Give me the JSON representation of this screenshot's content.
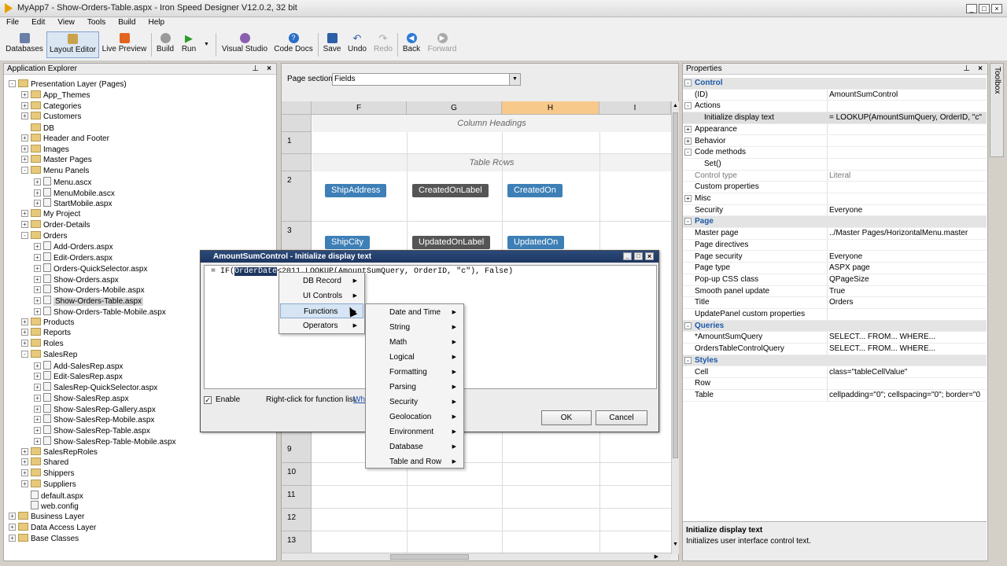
{
  "window": {
    "title": "MyApp7 - Show-Orders-Table.aspx - Iron Speed Designer V12.0.2, 32 bit"
  },
  "menu": [
    "File",
    "Edit",
    "View",
    "Tools",
    "Build",
    "Help"
  ],
  "toolbar": [
    {
      "label": "Databases",
      "icon": "database-icon",
      "enabled": true
    },
    {
      "label": "Layout Editor",
      "icon": "layout-icon",
      "enabled": true,
      "active": true
    },
    {
      "label": "Live Preview",
      "icon": "preview-icon",
      "enabled": true
    },
    {
      "label": "Build",
      "icon": "gear-icon",
      "enabled": true
    },
    {
      "label": "Run",
      "icon": "play-icon",
      "enabled": true
    },
    {
      "label": "Visual Studio",
      "icon": "visual-studio-icon",
      "enabled": true
    },
    {
      "label": "Code Docs",
      "icon": "help-icon",
      "enabled": true
    },
    {
      "label": "Save",
      "icon": "save-icon",
      "enabled": true
    },
    {
      "label": "Undo",
      "icon": "undo-icon",
      "enabled": true
    },
    {
      "label": "Redo",
      "icon": "redo-icon",
      "enabled": false
    },
    {
      "label": "Back",
      "icon": "back-icon",
      "enabled": true
    },
    {
      "label": "Forward",
      "icon": "forward-icon",
      "enabled": false
    }
  ],
  "explorer": {
    "title": "Application Explorer",
    "nodes": [
      {
        "label": "Presentation Layer (Pages)",
        "indent": 0,
        "exp": "-",
        "type": "folder"
      },
      {
        "label": "App_Themes",
        "indent": 1,
        "exp": "+",
        "type": "folder"
      },
      {
        "label": "Categories",
        "indent": 1,
        "exp": "+",
        "type": "folder"
      },
      {
        "label": "Customers",
        "indent": 1,
        "exp": "+",
        "type": "folder"
      },
      {
        "label": "DB",
        "indent": 1,
        "exp": "",
        "type": "folder"
      },
      {
        "label": "Header and Footer",
        "indent": 1,
        "exp": "+",
        "type": "folder"
      },
      {
        "label": "Images",
        "indent": 1,
        "exp": "+",
        "type": "folder"
      },
      {
        "label": "Master Pages",
        "indent": 1,
        "exp": "+",
        "type": "folder"
      },
      {
        "label": "Menu Panels",
        "indent": 1,
        "exp": "-",
        "type": "folder"
      },
      {
        "label": "Menu.ascx",
        "indent": 2,
        "exp": "+",
        "type": "file"
      },
      {
        "label": "MenuMobile.ascx",
        "indent": 2,
        "exp": "+",
        "type": "file"
      },
      {
        "label": "StartMobile.aspx",
        "indent": 2,
        "exp": "+",
        "type": "file"
      },
      {
        "label": "My Project",
        "indent": 1,
        "exp": "+",
        "type": "folder"
      },
      {
        "label": "Order-Details",
        "indent": 1,
        "exp": "+",
        "type": "folder"
      },
      {
        "label": "Orders",
        "indent": 1,
        "exp": "-",
        "type": "folder"
      },
      {
        "label": "Add-Orders.aspx",
        "indent": 2,
        "exp": "+",
        "type": "file"
      },
      {
        "label": "Edit-Orders.aspx",
        "indent": 2,
        "exp": "+",
        "type": "file"
      },
      {
        "label": "Orders-QuickSelector.aspx",
        "indent": 2,
        "exp": "+",
        "type": "file"
      },
      {
        "label": "Show-Orders.aspx",
        "indent": 2,
        "exp": "+",
        "type": "file"
      },
      {
        "label": "Show-Orders-Mobile.aspx",
        "indent": 2,
        "exp": "+",
        "type": "file"
      },
      {
        "label": "Show-Orders-Table.aspx",
        "indent": 2,
        "exp": "+",
        "type": "file",
        "selected": true
      },
      {
        "label": "Show-Orders-Table-Mobile.aspx",
        "indent": 2,
        "exp": "+",
        "type": "file"
      },
      {
        "label": "Products",
        "indent": 1,
        "exp": "+",
        "type": "folder"
      },
      {
        "label": "Reports",
        "indent": 1,
        "exp": "+",
        "type": "folder"
      },
      {
        "label": "Roles",
        "indent": 1,
        "exp": "+",
        "type": "folder"
      },
      {
        "label": "SalesRep",
        "indent": 1,
        "exp": "-",
        "type": "folder"
      },
      {
        "label": "Add-SalesRep.aspx",
        "indent": 2,
        "exp": "+",
        "type": "file"
      },
      {
        "label": "Edit-SalesRep.aspx",
        "indent": 2,
        "exp": "+",
        "type": "file"
      },
      {
        "label": "SalesRep-QuickSelector.aspx",
        "indent": 2,
        "exp": "+",
        "type": "file"
      },
      {
        "label": "Show-SalesRep.aspx",
        "indent": 2,
        "exp": "+",
        "type": "file"
      },
      {
        "label": "Show-SalesRep-Gallery.aspx",
        "indent": 2,
        "exp": "+",
        "type": "file"
      },
      {
        "label": "Show-SalesRep-Mobile.aspx",
        "indent": 2,
        "exp": "+",
        "type": "file"
      },
      {
        "label": "Show-SalesRep-Table.aspx",
        "indent": 2,
        "exp": "+",
        "type": "file"
      },
      {
        "label": "Show-SalesRep-Table-Mobile.aspx",
        "indent": 2,
        "exp": "+",
        "type": "file"
      },
      {
        "label": "SalesRepRoles",
        "indent": 1,
        "exp": "+",
        "type": "folder"
      },
      {
        "label": "Shared",
        "indent": 1,
        "exp": "+",
        "type": "folder"
      },
      {
        "label": "Shippers",
        "indent": 1,
        "exp": "+",
        "type": "folder"
      },
      {
        "label": "Suppliers",
        "indent": 1,
        "exp": "+",
        "type": "folder"
      },
      {
        "label": "default.aspx",
        "indent": 1,
        "exp": "",
        "type": "file"
      },
      {
        "label": "web.config",
        "indent": 1,
        "exp": "",
        "type": "file"
      },
      {
        "label": "Business Layer",
        "indent": 0,
        "exp": "+",
        "type": "folder"
      },
      {
        "label": "Data Access Layer",
        "indent": 0,
        "exp": "+",
        "type": "folder"
      },
      {
        "label": "Base Classes",
        "indent": 0,
        "exp": "+",
        "type": "folder"
      }
    ]
  },
  "editor": {
    "page_section_label": "Page section:",
    "page_section_value": "Fields",
    "columns": [
      "F",
      "G",
      "H",
      "I"
    ],
    "section_column_headings": "Column Headings",
    "section_table_rows": "Table Rows",
    "row_numbers": [
      "1",
      "2",
      "3",
      "9",
      "10",
      "11",
      "12",
      "13"
    ],
    "chips": {
      "r2": [
        "ShipAddress",
        "CreatedOnLabel",
        "CreatedOn"
      ],
      "r3": [
        "ShipCity",
        "UpdatedOnLabel",
        "UpdatedOn"
      ]
    }
  },
  "properties": {
    "title": "Properties",
    "rows": [
      {
        "k": "Control",
        "cat": true,
        "exp": "-"
      },
      {
        "k": "(ID)",
        "v": "AmountSumControl"
      },
      {
        "k": "Actions",
        "v": "",
        "exp": "-"
      },
      {
        "k": "Initialize display text",
        "v": "= LOOKUP(AmountSumQuery, OrderID, \"c\"",
        "indent": true,
        "hl": true
      },
      {
        "k": "Appearance",
        "v": "",
        "exp": "+"
      },
      {
        "k": "Behavior",
        "v": "",
        "exp": "+"
      },
      {
        "k": "Code methods",
        "v": "",
        "exp": "-"
      },
      {
        "k": "Set()",
        "v": "",
        "indent": true
      },
      {
        "k": "Control type",
        "v": "Literal",
        "sub": true
      },
      {
        "k": "Custom properties",
        "v": ""
      },
      {
        "k": "Misc",
        "v": "",
        "exp": "+"
      },
      {
        "k": "Security",
        "v": "Everyone"
      },
      {
        "k": "Page",
        "cat": true,
        "exp": "-"
      },
      {
        "k": "Master page",
        "v": "../Master Pages/HorizontalMenu.master"
      },
      {
        "k": "Page directives",
        "v": ""
      },
      {
        "k": "Page security",
        "v": "Everyone"
      },
      {
        "k": "Page type",
        "v": "ASPX page"
      },
      {
        "k": "Pop-up CSS class",
        "v": "QPageSize"
      },
      {
        "k": "Smooth panel update",
        "v": "True"
      },
      {
        "k": "Title",
        "v": "Orders"
      },
      {
        "k": "UpdatePanel custom properties",
        "v": ""
      },
      {
        "k": "Queries",
        "cat": true,
        "exp": "-"
      },
      {
        "k": "*AmountSumQuery",
        "v": "SELECT... FROM... WHERE..."
      },
      {
        "k": "OrdersTableControlQuery",
        "v": "SELECT... FROM... WHERE..."
      },
      {
        "k": "Styles",
        "cat": true,
        "exp": "-"
      },
      {
        "k": "Cell",
        "v": "class=\"tableCellValue\""
      },
      {
        "k": "Row",
        "v": ""
      },
      {
        "k": "Table",
        "v": "cellpadding=\"0\"; cellspacing=\"0\"; border=\"0"
      }
    ],
    "desc_title": "Initialize display text",
    "desc_text": "Initializes user interface control text."
  },
  "dialog": {
    "title": "AmountSumControl - Initialize display text",
    "expr_prefix": "= IF(",
    "expr_selected": "OrderDate",
    "expr_suffix": "<2011,LOOKUP(AmountSumQuery, OrderID, \"c\"), False)",
    "enable_label": "Enable",
    "hint": "Right-click for function list.",
    "hint_link": "Wh",
    "ok": "OK",
    "cancel": "Cancel"
  },
  "context_menu": [
    "DB Record",
    "UI Controls",
    "Functions",
    "Operators"
  ],
  "functions_menu": [
    "Date and Time",
    "String",
    "Math",
    "Logical",
    "Formatting",
    "Parsing",
    "Security",
    "Geolocation",
    "Environment",
    "Database",
    "Table and Row"
  ],
  "toolbox_label": "Toolbox",
  "colors": {
    "chip_blue": "#3d7fb6",
    "chip_gray": "#555555",
    "category": "#1c5aa8",
    "dialog_title": "#1d3660"
  }
}
